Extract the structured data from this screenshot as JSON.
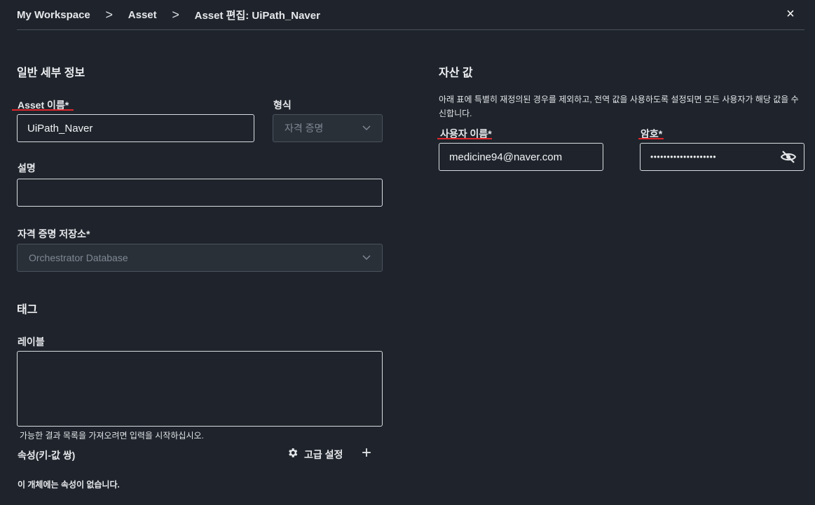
{
  "breadcrumb": {
    "items": [
      "My Workspace",
      "Asset",
      "Asset 편집: UiPath_Naver"
    ],
    "separator": ">"
  },
  "close_label": "×",
  "general": {
    "title": "일반 세부 정보",
    "asset_name_label": "Asset 이름*",
    "asset_name_value": "UiPath_Naver",
    "type_label": "형식",
    "type_value": "자격 증명",
    "description_label": "설명",
    "description_value": "",
    "store_label": "자격 증명 저장소*",
    "store_value": "Orchestrator Database"
  },
  "tags": {
    "title": "태그",
    "labels_label": "레이블",
    "labels_value": "",
    "labels_help": "가능한 결과 목록을 가져오려면 입력을 시작하십시오.",
    "props_label": "속성(키-값 쌍)",
    "advanced_label": "고급 설정",
    "add_label": "+",
    "no_props": "이 개체에는 속성이 없습니다."
  },
  "asset_value": {
    "title": "자산 값",
    "description": "아래 표에 특별히 재정의된 경우를 제외하고, 전역 값을 사용하도록 설정되면 모든 사용자가 해당 값을 수신합니다.",
    "username_label": "사용자 이름*",
    "username_value": "medicine94@naver.com",
    "password_label": "암호*",
    "password_value": "••••••••••••••••••••"
  },
  "colors": {
    "background": "#1f242c",
    "annotation_red": "#e0262a",
    "input_border": "#d9dde2",
    "disabled_bg": "#2a3038"
  }
}
